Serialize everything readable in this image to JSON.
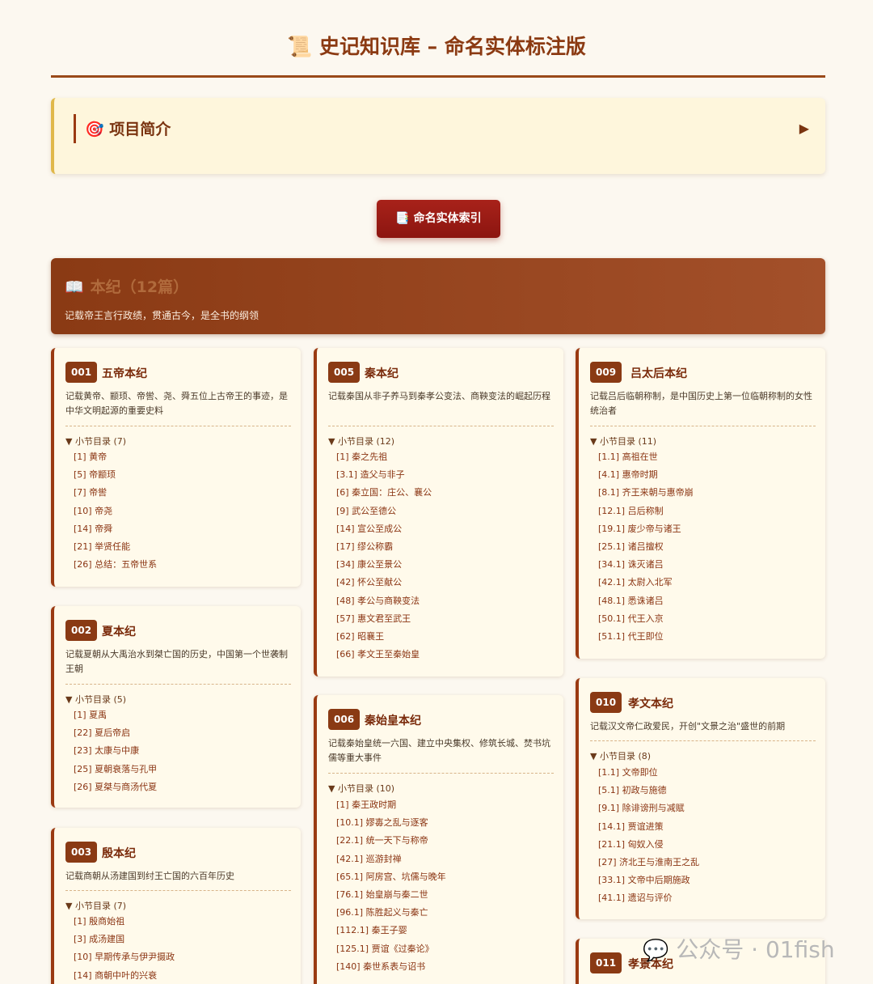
{
  "header": {
    "icon": "scroll-icon",
    "title": "📜 史记知识库 – 命名实体标注版"
  },
  "intro": {
    "title": "🎯 项目简介",
    "toggle": "▶"
  },
  "index_button": {
    "label": "📑 命名实体索引"
  },
  "section": {
    "icon": "📖",
    "title": "本纪（12篇）",
    "description": "记载帝王言行政绩，贯通古今，是全书的纲领"
  },
  "cards": [
    {
      "num": "001",
      "title": "五帝本纪",
      "desc": "记载黄帝、颛顼、帝喾、尧、舜五位上古帝王的事迹，是中华文明起源的重要史料",
      "toc_label": "▼ 小节目录 (7)",
      "toc": [
        "[1] 黄帝",
        "[5] 帝颛顼",
        "[7] 帝喾",
        "[10] 帝尧",
        "[14] 帝舜",
        "[21] 举贤任能",
        "[26] 总结：五帝世系"
      ]
    },
    {
      "num": "002",
      "title": "夏本纪",
      "desc": "记载夏朝从大禹治水到桀亡国的历史，中国第一个世袭制王朝",
      "toc_label": "▼ 小节目录 (5)",
      "toc": [
        "[1] 夏禹",
        "[22] 夏后帝启",
        "[23] 太康与中康",
        "[25] 夏朝衰落与孔甲",
        "[26] 夏桀与商汤代夏"
      ]
    },
    {
      "num": "003",
      "title": "殷本纪",
      "desc": "记载商朝从汤建国到纣王亡国的六百年历史",
      "toc_label": "▼ 小节目录 (7)",
      "toc": [
        "[1] 殷商始祖",
        "[3] 成汤建国",
        "[10] 早期传承与伊尹摄政",
        "[14] 商朝中叶的兴衰"
      ]
    },
    {
      "num": "005",
      "title": "秦本纪",
      "desc": "记载秦国从非子养马到秦孝公变法、商鞅变法的崛起历程",
      "toc_label": "▼ 小节目录 (12)",
      "toc": [
        "[1] 秦之先祖",
        "[3.1] 造父与非子",
        "[6] 秦立国：庄公、襄公",
        "[9] 武公至德公",
        "[14] 宣公至成公",
        "[17] 缪公称霸",
        "[34] 康公至景公",
        "[42] 怀公至献公",
        "[48] 孝公与商鞅变法",
        "[57] 惠文君至武王",
        "[62] 昭襄王",
        "[66] 孝文王至秦始皇"
      ]
    },
    {
      "num": "006",
      "title": "秦始皇本纪",
      "desc": "记载秦始皇统一六国、建立中央集权、修筑长城、焚书坑儒等重大事件",
      "toc_label": "▼ 小节目录 (10)",
      "toc": [
        "[1] 秦王政时期",
        "[10.1] 嫪毐之乱与逐客",
        "[22.1] 统一天下与称帝",
        "[42.1] 巡游封禅",
        "[65.1] 阿房宫、坑儒与晚年",
        "[76.1] 始皇崩与秦二世",
        "[96.1] 陈胜起义与秦亡",
        "[112.1] 秦王子婴",
        "[125.1] 贾谊《过秦论》",
        "[140] 秦世系表与诏书"
      ]
    },
    {
      "num": "009",
      "title": "吕太后本纪",
      "desc": "记载吕后临朝称制，是中国历史上第一位临朝称制的女性统治者",
      "toc_label": "▼ 小节目录 (11)",
      "toc": [
        "[1.1] 高祖在世",
        "[4.1] 惠帝时期",
        "[8.1] 齐王来朝与惠帝崩",
        "[12.1] 吕后称制",
        "[19.1] 废少帝与诸王",
        "[25.1] 诸吕擅权",
        "[34.1] 诛灭诸吕",
        "[42.1] 太尉入北军",
        "[48.1] 悉诛诸吕",
        "[50.1] 代王入京",
        "[51.1] 代王即位"
      ]
    },
    {
      "num": "010",
      "title": "孝文本纪",
      "desc": "记载汉文帝仁政爱民，开创\"文景之治\"盛世的前期",
      "toc_label": "▼ 小节目录 (8)",
      "toc": [
        "[1.1] 文帝即位",
        "[5.1] 初政与施德",
        "[9.1] 除诽谤刑与减赋",
        "[14.1] 贾谊进策",
        "[21.1] 匈奴入侵",
        "[27] 济北王与淮南王之乱",
        "[33.1] 文帝中后期施政",
        "[41.1] 遗诏与评价"
      ]
    },
    {
      "num": "011",
      "title": "孝景本纪",
      "desc": "",
      "toc_label": "",
      "toc": []
    }
  ],
  "watermark": {
    "icon": "wechat-icon",
    "text": "公众号 · 01fish"
  }
}
